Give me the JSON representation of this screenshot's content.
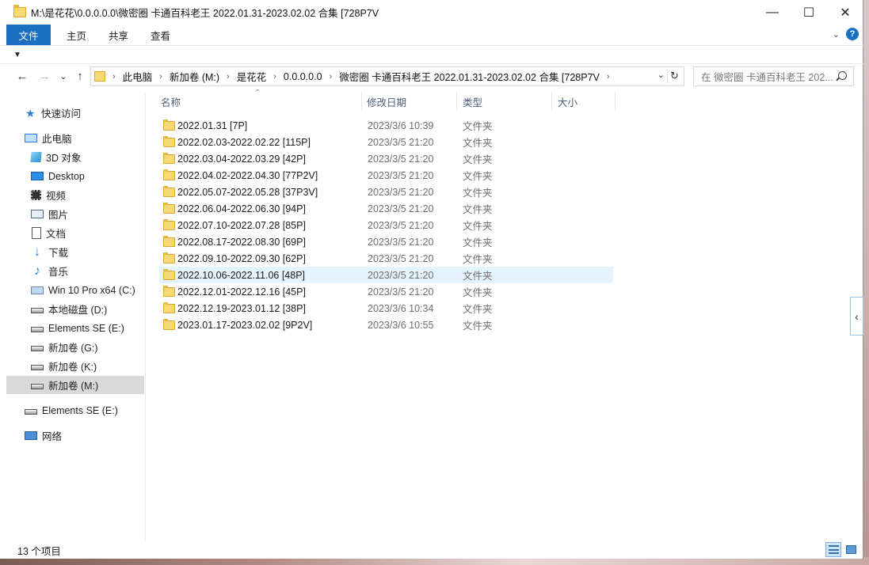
{
  "window": {
    "title": "M:\\是花花\\0.0.0.0.0\\微密圈 卡通百科老王 2022.01.31-2023.02.02 合集 [728P7V",
    "buttons": {
      "minimize": "—",
      "maximize": "☐",
      "close": "✕"
    }
  },
  "ribbon": {
    "tabs": [
      "文件",
      "主页",
      "共享",
      "查看"
    ],
    "expand_icon": "chevron-down-icon",
    "help_label": "?"
  },
  "nav": {
    "back": "←",
    "forward": "→",
    "recent": "⌄",
    "up": "↑",
    "breadcrumbs": [
      "此电脑",
      "新加卷 (M:)",
      "是花花",
      "0.0.0.0.0",
      "微密圈 卡通百科老王 2022.01.31-2023.02.02 合集 [728P7V"
    ],
    "search_placeholder": "在 微密圈 卡通百科老王 202..."
  },
  "sidebar": {
    "items": [
      {
        "label": "快速访问",
        "icon": "quick-access-star-icon"
      },
      {
        "label": "此电脑",
        "icon": "this-pc-icon"
      },
      {
        "label": "3D 对象",
        "icon": "3d-objects-icon"
      },
      {
        "label": "Desktop",
        "icon": "desktop-icon"
      },
      {
        "label": "视频",
        "icon": "videos-icon"
      },
      {
        "label": "图片",
        "icon": "pictures-icon"
      },
      {
        "label": "文档",
        "icon": "documents-icon"
      },
      {
        "label": "下载",
        "icon": "downloads-icon"
      },
      {
        "label": "音乐",
        "icon": "music-icon"
      },
      {
        "label": "Win 10 Pro x64 (C:)",
        "icon": "windows-drive-icon"
      },
      {
        "label": "本地磁盘 (D:)",
        "icon": "drive-icon"
      },
      {
        "label": "Elements SE (E:)",
        "icon": "drive-icon"
      },
      {
        "label": "新加卷 (G:)",
        "icon": "drive-icon"
      },
      {
        "label": "新加卷 (K:)",
        "icon": "drive-icon"
      },
      {
        "label": "新加卷 (M:)",
        "icon": "drive-icon",
        "selected": true
      },
      {
        "label": "Elements SE (E:)",
        "icon": "drive-icon"
      },
      {
        "label": "网络",
        "icon": "network-icon"
      }
    ]
  },
  "list": {
    "columns": [
      "名称",
      "修改日期",
      "类型",
      "大小"
    ],
    "rows": [
      {
        "name": "2022.01.31 [7P]",
        "date": "2023/3/6 10:39",
        "type": "文件夹"
      },
      {
        "name": "2022.02.03-2022.02.22 [115P]",
        "date": "2023/3/5 21:20",
        "type": "文件夹"
      },
      {
        "name": "2022.03.04-2022.03.29 [42P]",
        "date": "2023/3/5 21:20",
        "type": "文件夹"
      },
      {
        "name": "2022.04.02-2022.04.30 [77P2V]",
        "date": "2023/3/5 21:20",
        "type": "文件夹"
      },
      {
        "name": "2022.05.07-2022.05.28 [37P3V]",
        "date": "2023/3/5 21:20",
        "type": "文件夹"
      },
      {
        "name": "2022.06.04-2022.06.30 [94P]",
        "date": "2023/3/5 21:20",
        "type": "文件夹"
      },
      {
        "name": "2022.07.10-2022.07.28 [85P]",
        "date": "2023/3/5 21:20",
        "type": "文件夹"
      },
      {
        "name": "2022.08.17-2022.08.30 [69P]",
        "date": "2023/3/5 21:20",
        "type": "文件夹"
      },
      {
        "name": "2022.09.10-2022.09.30 [62P]",
        "date": "2023/3/5 21:20",
        "type": "文件夹"
      },
      {
        "name": "2022.10.06-2022.11.06 [48P]",
        "date": "2023/3/5 21:20",
        "type": "文件夹",
        "selected": true
      },
      {
        "name": "2022.12.01-2022.12.16 [45P]",
        "date": "2023/3/5 21:20",
        "type": "文件夹"
      },
      {
        "name": "2022.12.19-2023.01.12 [38P]",
        "date": "2023/3/6 10:34",
        "type": "文件夹"
      },
      {
        "name": "2023.01.17-2023.02.02 [9P2V]",
        "date": "2023/3/6 10:55",
        "type": "文件夹"
      }
    ]
  },
  "status": {
    "count": "13 个项目"
  },
  "colors": {
    "accent": "#1a6fc3",
    "selection": "#e5f3ff",
    "folder": "#f8d775",
    "header_text": "#4c607a"
  }
}
